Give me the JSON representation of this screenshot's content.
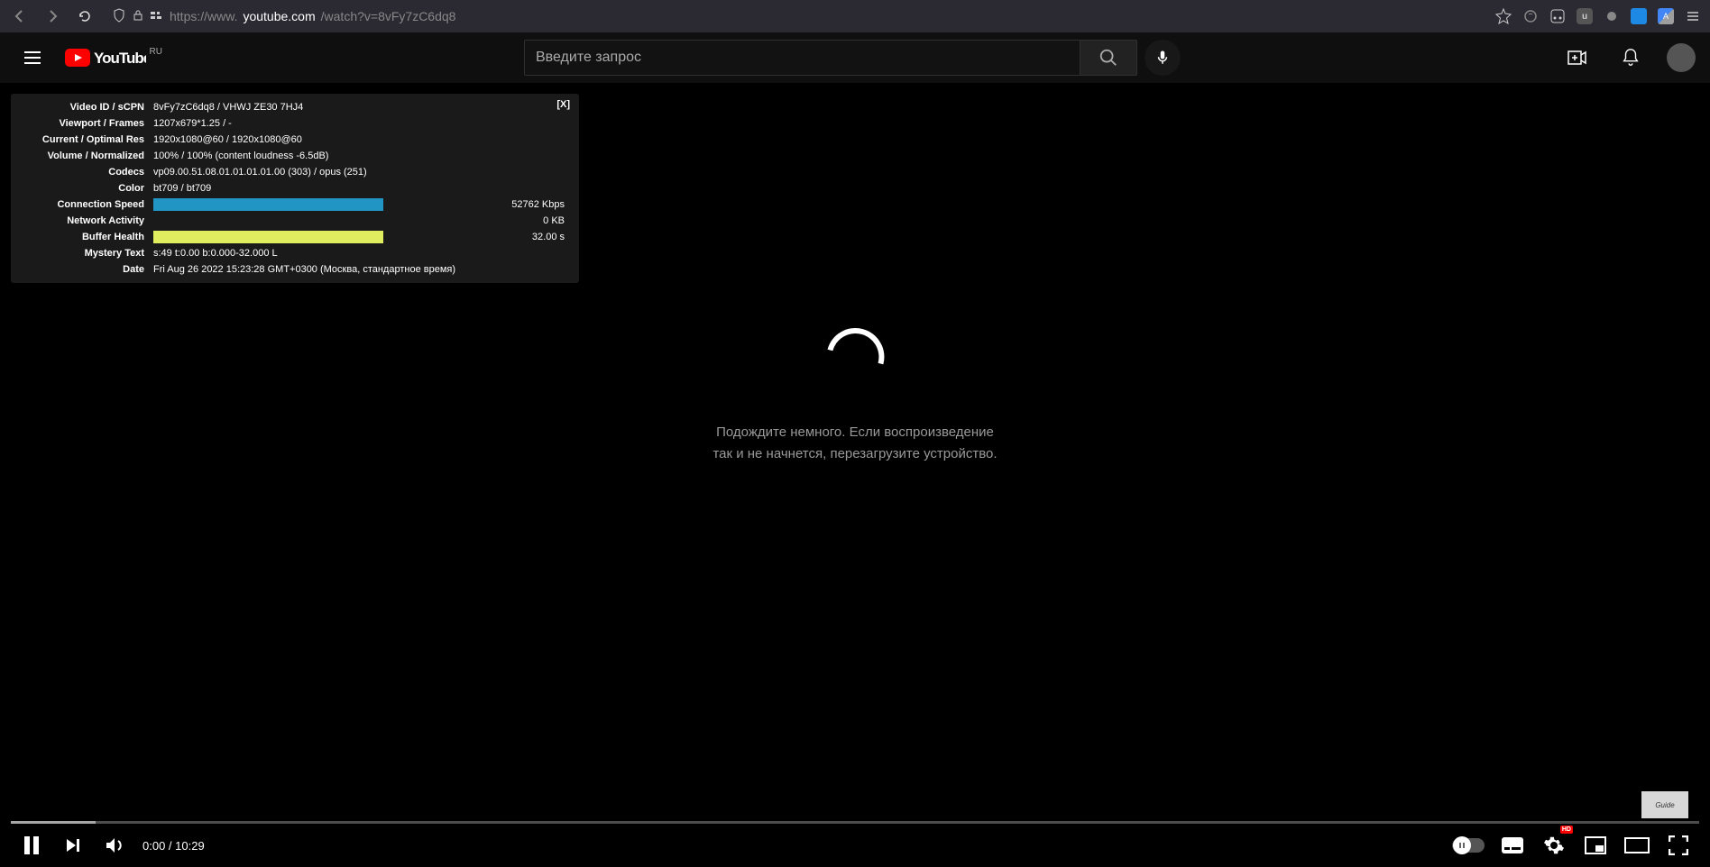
{
  "browser": {
    "url_prefix": "https://www.",
    "url_domain": "youtube.com",
    "url_path": "/watch?v=8vFy7zC6dq8"
  },
  "masthead": {
    "logo_region": "RU",
    "search_placeholder": "Введите запрос"
  },
  "stats": {
    "close": "[X]",
    "rows": [
      {
        "label": "Video ID / sCPN",
        "value": "8vFy7zC6dq8  /  VHWJ  ZE30  7HJ4"
      },
      {
        "label": "Viewport / Frames",
        "value": "1207x679*1.25 / -"
      },
      {
        "label": "Current / Optimal Res",
        "value": "1920x1080@60 / 1920x1080@60"
      },
      {
        "label": "Volume / Normalized",
        "value": "100% / 100% (content loudness -6.5dB)"
      },
      {
        "label": "Codecs",
        "value": "vp09.00.51.08.01.01.01.01.00 (303) / opus (251)"
      },
      {
        "label": "Color",
        "value": "bt709 / bt709"
      }
    ],
    "conn_label": "Connection Speed",
    "conn_value": "52762 Kbps",
    "net_label": "Network Activity",
    "net_value": "0 KB",
    "buf_label": "Buffer Health",
    "buf_value": "32.00 s",
    "mystery_label": "Mystery Text",
    "mystery_value": "s:49 t:0.00 b:0.000-32.000 L",
    "date_label": "Date",
    "date_value": "Fri Aug 26 2022 15:23:28 GMT+0300 (Москва, стандартное время)"
  },
  "center": {
    "line1": "Подождите немного. Если воспроизведение",
    "line2": "так и не начнется, перезагрузите устройство."
  },
  "player": {
    "time": "0:00 / 10:29",
    "hd": "HD"
  },
  "watermark": "Guide"
}
